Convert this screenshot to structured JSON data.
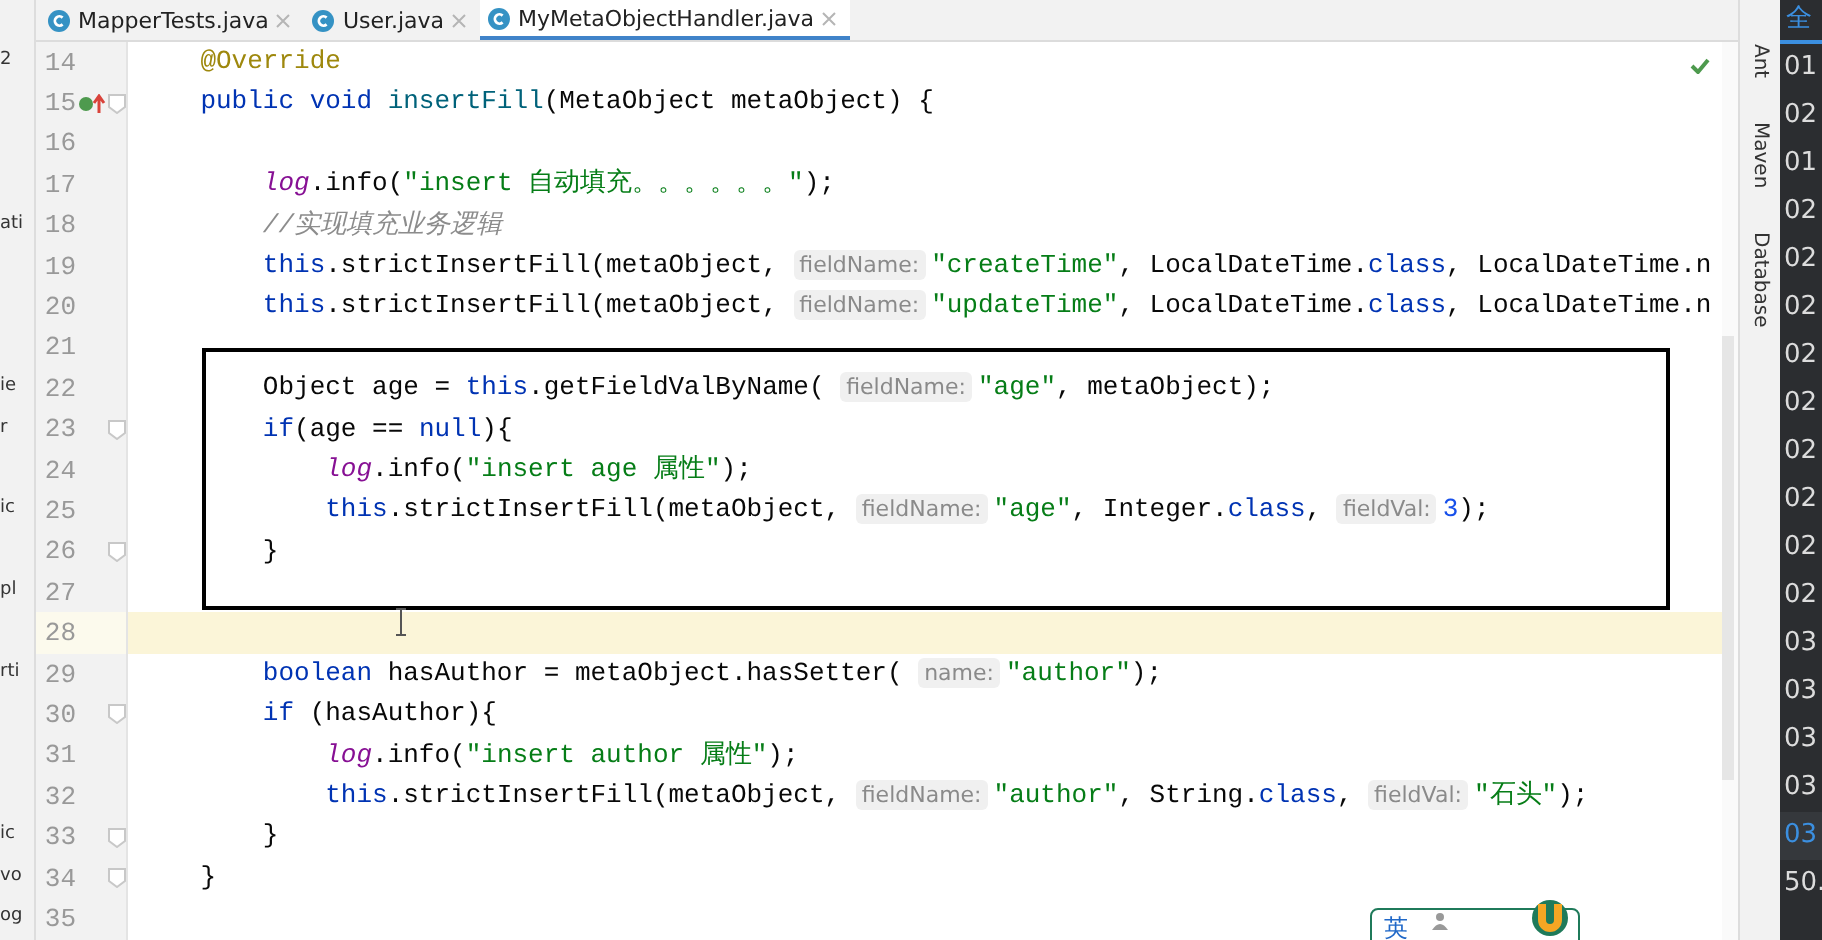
{
  "tabs": [
    {
      "label": "MapperTests.java",
      "selected": false
    },
    {
      "label": "User.java",
      "selected": false
    },
    {
      "label": "MyMetaObjectHandler.java",
      "selected": true
    }
  ],
  "editor": {
    "lines": [
      {
        "number": "14",
        "fold": false,
        "current": false,
        "override": false,
        "project_text": "2",
        "tokens": [
          {
            "kind": "annotation",
            "text": "    @Override"
          }
        ]
      },
      {
        "number": "15",
        "fold": true,
        "current": false,
        "override": true,
        "tokens": [
          {
            "kind": "keyword",
            "text": "    public void "
          },
          {
            "kind": "method",
            "text": "insertFill"
          },
          {
            "kind": "plain",
            "text": "(MetaObject metaObject) {"
          }
        ]
      },
      {
        "number": "16",
        "fold": false,
        "current": false,
        "override": false
      },
      {
        "number": "17",
        "fold": false,
        "current": false,
        "override": false,
        "tokens": [
          {
            "kind": "field",
            "text": "        log"
          },
          {
            "kind": "plain",
            "text": ".info("
          },
          {
            "kind": "string",
            "text": "\"insert 自动填充。。。。。。\""
          },
          {
            "kind": "plain",
            "text": ");"
          }
        ]
      },
      {
        "number": "18",
        "fold": false,
        "current": false,
        "override": false,
        "project_text": "ati",
        "tokens": [
          {
            "kind": "comment",
            "text": "        //实现填充业务逻辑"
          }
        ]
      },
      {
        "number": "19",
        "fold": false,
        "current": false,
        "override": false,
        "tokens": [
          {
            "kind": "keyword",
            "text": "        this"
          },
          {
            "kind": "plain",
            "text": ".strictInsertFill(metaObject, "
          },
          {
            "kind": "hint",
            "text": "fieldName:"
          },
          {
            "kind": "string",
            "text": "\"createTime\""
          },
          {
            "kind": "plain",
            "text": ", LocalDateTime."
          },
          {
            "kind": "keyword",
            "text": "class"
          },
          {
            "kind": "plain",
            "text": ", LocalDateTime.n"
          }
        ]
      },
      {
        "number": "20",
        "fold": false,
        "current": false,
        "override": false,
        "tokens": [
          {
            "kind": "keyword",
            "text": "        this"
          },
          {
            "kind": "plain",
            "text": ".strictInsertFill(metaObject, "
          },
          {
            "kind": "hint",
            "text": "fieldName:"
          },
          {
            "kind": "string",
            "text": "\"updateTime\""
          },
          {
            "kind": "plain",
            "text": ", LocalDateTime."
          },
          {
            "kind": "keyword",
            "text": "class"
          },
          {
            "kind": "plain",
            "text": ", LocalDateTime.n"
          }
        ]
      },
      {
        "number": "21",
        "fold": false,
        "current": false,
        "override": false
      },
      {
        "number": "22",
        "fold": false,
        "current": false,
        "override": false,
        "project_text": "ie",
        "tokens": [
          {
            "kind": "plain",
            "text": "        Object age = "
          },
          {
            "kind": "keyword",
            "text": "this"
          },
          {
            "kind": "plain",
            "text": ".getFieldValByName( "
          },
          {
            "kind": "hint",
            "text": "fieldName:"
          },
          {
            "kind": "string",
            "text": "\"age\""
          },
          {
            "kind": "plain",
            "text": ", metaObject);"
          }
        ]
      },
      {
        "number": "23",
        "fold": true,
        "current": false,
        "override": false,
        "project_text": "r",
        "tokens": [
          {
            "kind": "keyword",
            "text": "        if"
          },
          {
            "kind": "plain",
            "text": "(age == "
          },
          {
            "kind": "keyword",
            "text": "null"
          },
          {
            "kind": "plain",
            "text": "){"
          }
        ]
      },
      {
        "number": "24",
        "fold": false,
        "current": false,
        "override": false,
        "tokens": [
          {
            "kind": "field",
            "text": "            log"
          },
          {
            "kind": "plain",
            "text": ".info("
          },
          {
            "kind": "string",
            "text": "\"insert age 属性\""
          },
          {
            "kind": "plain",
            "text": ");"
          }
        ]
      },
      {
        "number": "25",
        "fold": false,
        "current": false,
        "override": false,
        "project_text": "ic",
        "tokens": [
          {
            "kind": "keyword",
            "text": "            this"
          },
          {
            "kind": "plain",
            "text": ".strictInsertFill(metaObject, "
          },
          {
            "kind": "hint",
            "text": "fieldName:"
          },
          {
            "kind": "string",
            "text": "\"age\""
          },
          {
            "kind": "plain",
            "text": ", Integer."
          },
          {
            "kind": "keyword",
            "text": "class"
          },
          {
            "kind": "plain",
            "text": ", "
          },
          {
            "kind": "hint",
            "text": "fieldVal:"
          },
          {
            "kind": "number",
            "text": "3"
          },
          {
            "kind": "plain",
            "text": ");"
          }
        ]
      },
      {
        "number": "26",
        "fold": true,
        "current": false,
        "override": false,
        "tokens": [
          {
            "kind": "plain",
            "text": "        }"
          }
        ]
      },
      {
        "number": "27",
        "fold": false,
        "current": false,
        "override": false,
        "project_text": "pl"
      },
      {
        "number": "28",
        "fold": false,
        "current": true,
        "override": false
      },
      {
        "number": "29",
        "fold": false,
        "current": false,
        "override": false,
        "project_text": "rti",
        "tokens": [
          {
            "kind": "keyword",
            "text": "        boolean "
          },
          {
            "kind": "plain",
            "text": "hasAuthor = metaObject.hasSetter( "
          },
          {
            "kind": "hint",
            "text": "name:"
          },
          {
            "kind": "string",
            "text": "\"author\""
          },
          {
            "kind": "plain",
            "text": ");"
          }
        ]
      },
      {
        "number": "30",
        "fold": true,
        "current": false,
        "override": false,
        "tokens": [
          {
            "kind": "keyword",
            "text": "        if "
          },
          {
            "kind": "plain",
            "text": "(hasAuthor){"
          }
        ]
      },
      {
        "number": "31",
        "fold": false,
        "current": false,
        "override": false,
        "tokens": [
          {
            "kind": "field",
            "text": "            log"
          },
          {
            "kind": "plain",
            "text": ".info("
          },
          {
            "kind": "string",
            "text": "\"insert author 属性\""
          },
          {
            "kind": "plain",
            "text": ");"
          }
        ]
      },
      {
        "number": "32",
        "fold": false,
        "current": false,
        "override": false,
        "tokens": [
          {
            "kind": "keyword",
            "text": "            this"
          },
          {
            "kind": "plain",
            "text": ".strictInsertFill(metaObject, "
          },
          {
            "kind": "hint",
            "text": "fieldName:"
          },
          {
            "kind": "string",
            "text": "\"author\""
          },
          {
            "kind": "plain",
            "text": ", String."
          },
          {
            "kind": "keyword",
            "text": "class"
          },
          {
            "kind": "plain",
            "text": ", "
          },
          {
            "kind": "hint",
            "text": "fieldVal:"
          },
          {
            "kind": "string",
            "text": "\"石头\""
          },
          {
            "kind": "plain",
            "text": ");"
          }
        ]
      },
      {
        "number": "33",
        "fold": true,
        "current": false,
        "override": false,
        "project_text": "ic",
        "tokens": [
          {
            "kind": "plain",
            "text": "        }"
          }
        ]
      },
      {
        "number": "34",
        "fold": true,
        "current": false,
        "override": false,
        "project_text": "vo",
        "tokens": [
          {
            "kind": "plain",
            "text": "    }"
          }
        ]
      },
      {
        "number": "35",
        "fold": false,
        "current": false,
        "override": false,
        "project_text": "og"
      }
    ]
  },
  "tool_strip": [
    "Ant",
    "Maven",
    "Database"
  ],
  "side_panel": {
    "header": "全",
    "items": [
      {
        "text": "01",
        "selected": false
      },
      {
        "text": "02",
        "selected": false
      },
      {
        "text": "01",
        "selected": false
      },
      {
        "text": "02",
        "selected": false
      },
      {
        "text": "02",
        "selected": false
      },
      {
        "text": "02",
        "selected": false
      },
      {
        "text": "02",
        "selected": false
      },
      {
        "text": "02",
        "selected": false
      },
      {
        "text": "02",
        "selected": false
      },
      {
        "text": "02",
        "selected": false
      },
      {
        "text": "02",
        "selected": false
      },
      {
        "text": "02",
        "selected": false
      },
      {
        "text": "03",
        "selected": false
      },
      {
        "text": "03",
        "selected": false
      },
      {
        "text": "03",
        "selected": false
      },
      {
        "text": "03",
        "selected": false
      },
      {
        "text": "03",
        "selected": true
      },
      {
        "text": "50.",
        "selected": false
      }
    ]
  },
  "ime": {
    "label": "英"
  }
}
